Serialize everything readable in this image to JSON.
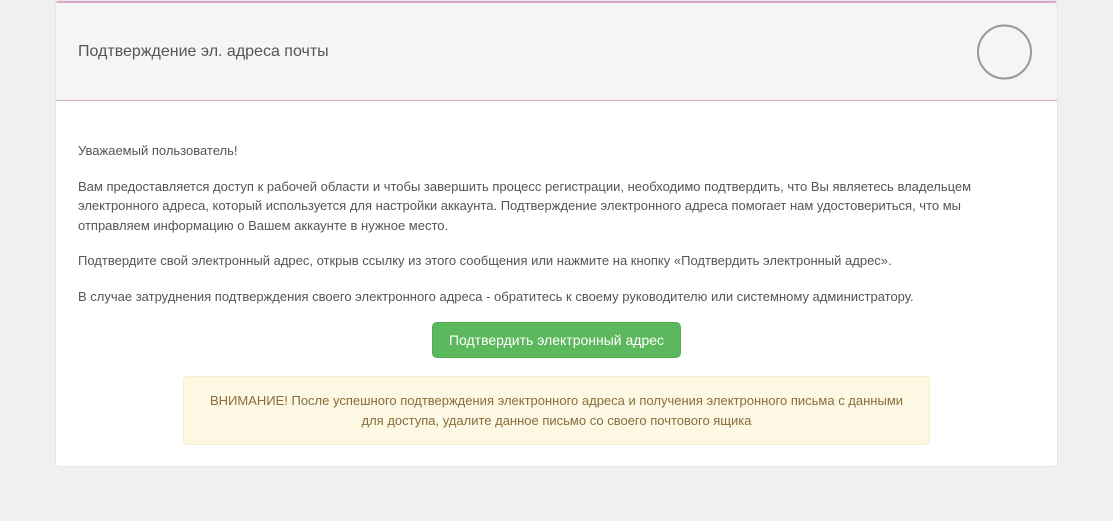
{
  "header": {
    "title": "Подтверждение эл. адреса почты"
  },
  "body": {
    "greeting": "Уважаемый пользователь!",
    "p1": "Вам предоставляется доступ к рабочей области и чтобы завершить процесс регистрации, необходимо подтвердить, что Вы являетесь владельцем электронного адреса, который используется для настройки аккаунта. Подтверждение электронного адреса помогает нам удостовериться, что мы отправляем информацию о Вашем аккаунте в нужное место.",
    "p2": "Подтвердите свой электронный адрес, открыв ссылку из этого сообщения или нажмите на кнопку «Подтвердить электронный адрес».",
    "p3": "В случае затруднения подтверждения своего электронного адреса - обратитесь к своему руководителю или системному администратору."
  },
  "button": {
    "confirm_label": "Подтвердить электронный адрес"
  },
  "alert": {
    "text": "ВНИМАНИЕ! После успешного подтверждения электронного адреса и получения электронного письма с данными для доступа, удалите данное письмо со своего почтового ящика"
  }
}
